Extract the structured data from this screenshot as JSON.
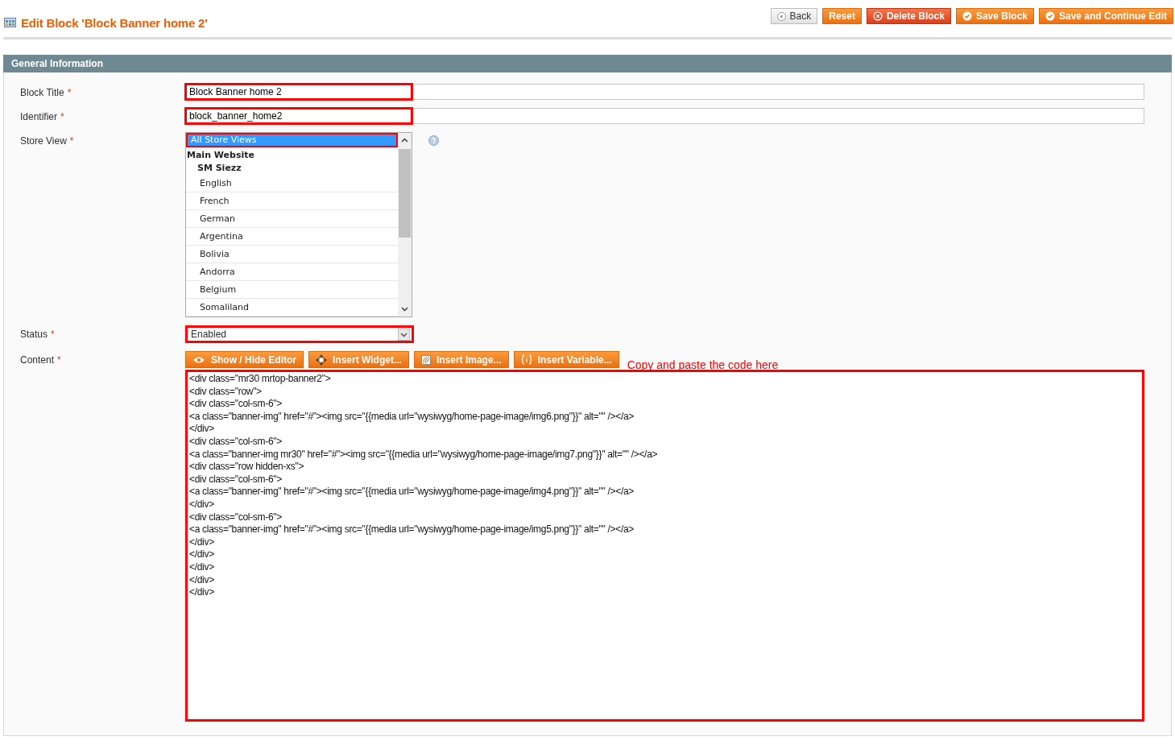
{
  "page_title": "Edit Block 'Block Banner home 2'",
  "actions": [
    {
      "label": "Back",
      "kind": "back"
    },
    {
      "label": "Reset",
      "kind": "plain"
    },
    {
      "label": "Delete Block",
      "kind": "delete"
    },
    {
      "label": "Save Block",
      "kind": "save"
    },
    {
      "label": "Save and Continue Edit",
      "kind": "save"
    }
  ],
  "section_title": "General Information",
  "fields": [
    {
      "label": "Block Title",
      "required_mark": "*",
      "kind": "text",
      "value": "Block Banner home 2",
      "highlighted": true
    },
    {
      "label": "Identifier",
      "required_mark": "*",
      "kind": "text",
      "value": "block_banner_home2",
      "highlighted": true
    },
    {
      "label": "Store View",
      "required_mark": "*",
      "kind": "multiselect",
      "highlighted": true,
      "help": true,
      "options": [
        {
          "label": "All Store Views",
          "kind": "option",
          "selected": true
        },
        {
          "label": "Main Website",
          "kind": "website",
          "selected": false
        },
        {
          "label": "SM Siezz",
          "kind": "store",
          "selected": false
        },
        {
          "label": "English",
          "kind": "option",
          "selected": false
        },
        {
          "label": "French",
          "kind": "option",
          "selected": false
        },
        {
          "label": "German",
          "kind": "option",
          "selected": false
        },
        {
          "label": "Argentina",
          "kind": "option",
          "selected": false
        },
        {
          "label": "Bolivia",
          "kind": "option",
          "selected": false
        },
        {
          "label": "Andorra",
          "kind": "option",
          "selected": false
        },
        {
          "label": "Belgium",
          "kind": "option",
          "selected": false
        },
        {
          "label": "Somaliland",
          "kind": "option",
          "selected": false
        }
      ]
    },
    {
      "label": "Status",
      "required_mark": "*",
      "kind": "select",
      "value": "Enabled",
      "highlighted": true
    },
    {
      "label": "Content",
      "required_mark": "*",
      "kind": "editor",
      "highlighted": true,
      "editor_buttons": [
        {
          "label": "Show / Hide Editor",
          "kind": "eye"
        },
        {
          "label": "Insert Widget...",
          "kind": "widget"
        },
        {
          "label": "Insert Image...",
          "kind": "image"
        },
        {
          "label": "Insert Variable...",
          "kind": "variable"
        }
      ],
      "annotation": "Copy and paste the code here",
      "value": "<div class=\"mr30 mrtop-banner2\">\n<div class=\"row\">\n<div class=\"col-sm-6\">\n<a class=\"banner-img\" href=\"#\"><img src=\"{{media url=\"wysiwyg/home-page-image/img6.png\"}}\" alt=\"\" /></a>\n</div>\n<div class=\"col-sm-6\">\n<a class=\"banner-img mr30\" href=\"#\"><img src=\"{{media url=\"wysiwyg/home-page-image/img7.png\"}}\" alt=\"\" /></a>\n<div class=\"row hidden-xs\">\n<div class=\"col-sm-6\">\n<a class=\"banner-img\" href=\"#\"><img src=\"{{media url=\"wysiwyg/home-page-image/img4.png\"}}\" alt=\"\" /></a>\n</div>\n<div class=\"col-sm-6\">\n<a class=\"banner-img\" href=\"#\"><img src=\"{{media url=\"wysiwyg/home-page-image/img5.png\"}}\" alt=\"\" /></a>\n</div>\n</div>\n</div>\n</div>\n</div>"
    }
  ]
}
